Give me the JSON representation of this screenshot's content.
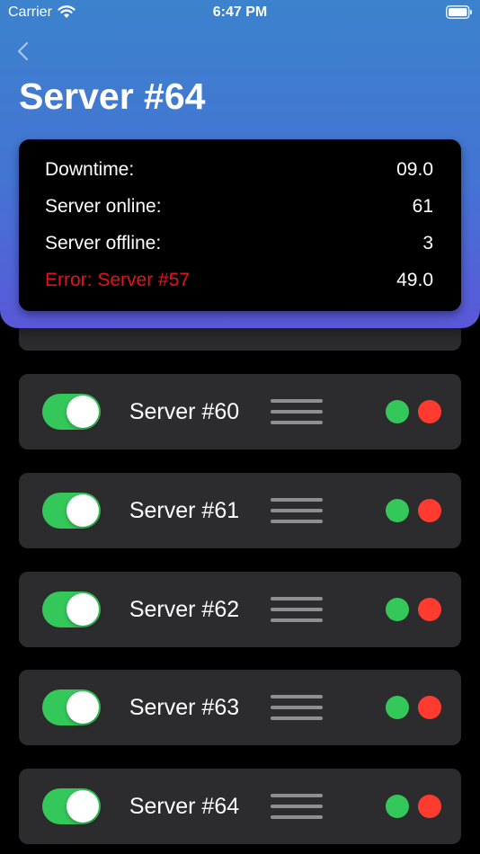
{
  "status_bar": {
    "carrier": "Carrier",
    "time": "6:47 PM",
    "icons": [
      "wifi-icon",
      "battery-icon"
    ]
  },
  "nav": {
    "back_icon": "chevron-left-icon",
    "title": "Server #64"
  },
  "summary": {
    "rows": [
      {
        "label": "Downtime:",
        "value": "09.0"
      },
      {
        "label": "Server online:",
        "value": "61"
      },
      {
        "label": "Server offline:",
        "value": "3"
      },
      {
        "label": "Error: Server #57",
        "value": "49.0"
      }
    ]
  },
  "servers": [
    {
      "name": "Server #60",
      "enabled": true
    },
    {
      "name": "Server #61",
      "enabled": true
    },
    {
      "name": "Server #62",
      "enabled": true
    },
    {
      "name": "Server #63",
      "enabled": true
    },
    {
      "name": "Server #64",
      "enabled": true
    }
  ],
  "colors": {
    "header_gradient_top": "#3c82cc",
    "header_gradient_bottom": "#5a58d8",
    "card_background": "#2c2c2e",
    "toggle_on": "#34c759",
    "status_green": "#34c759",
    "status_red": "#ff3b30",
    "error_text": "#e5121a",
    "handle": "#8e8e93"
  }
}
